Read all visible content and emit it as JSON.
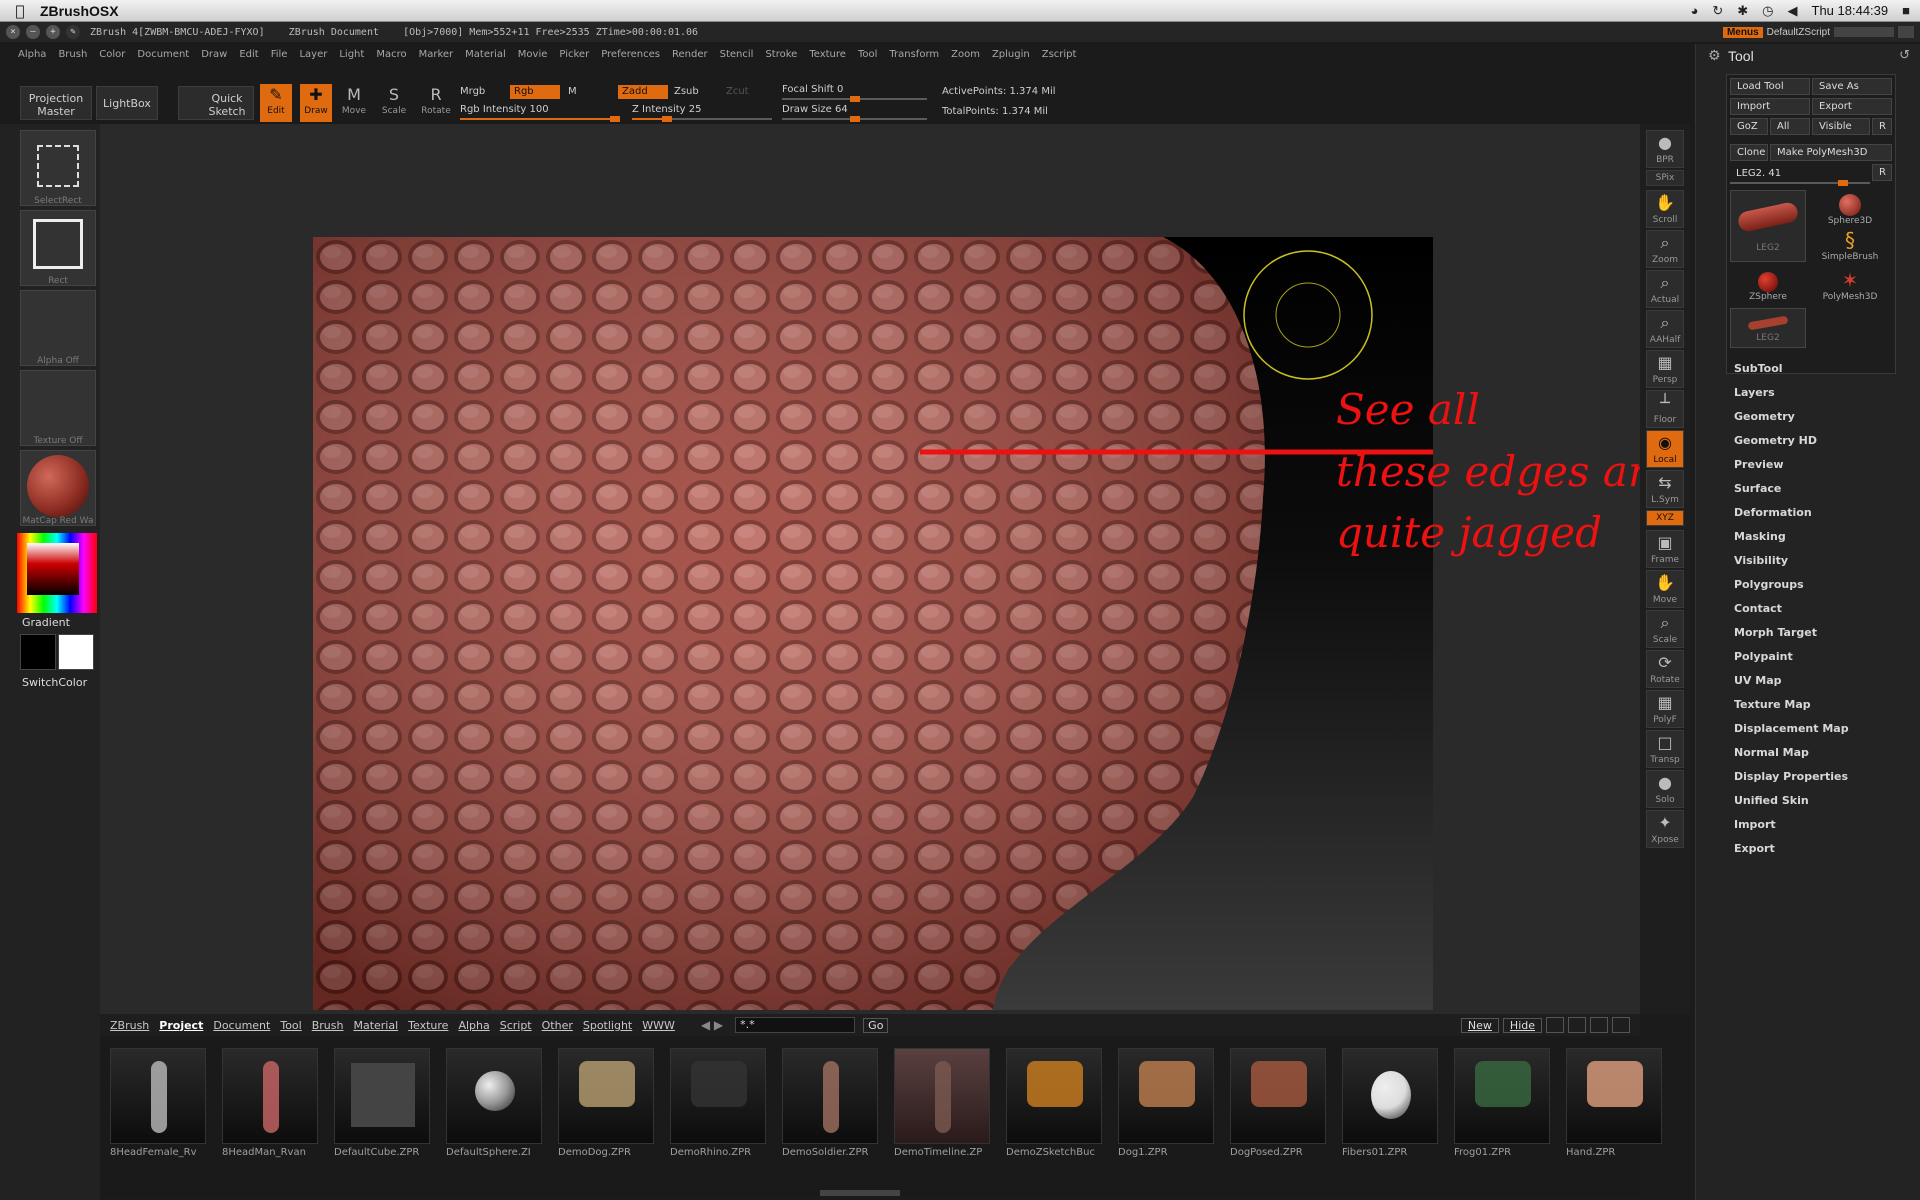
{
  "mac": {
    "app": "ZBrushOSX",
    "clock": "Thu 18:44:39"
  },
  "titlebar": {
    "info": "ZBrush 4[ZWBM-BMCU-ADEJ-FYXO]    ZBrush Document    [Obj>7000] Mem>552+11 Free>2535 ZTime>00:00:01.06",
    "menus": "Menus",
    "script": "DefaultZScript"
  },
  "menu": [
    "Alpha",
    "Brush",
    "Color",
    "Document",
    "Draw",
    "Edit",
    "File",
    "Layer",
    "Light",
    "Macro",
    "Marker",
    "Material",
    "Movie",
    "Picker",
    "Preferences",
    "Render",
    "Stencil",
    "Stroke",
    "Texture",
    "Tool",
    "Transform",
    "Zoom",
    "Zplugin",
    "Zscript"
  ],
  "toolbar": {
    "projection_master": "Projection Master",
    "lightbox": "LightBox",
    "quick_sketch": "Quick Sketch",
    "edit": "Edit",
    "draw": "Draw",
    "move": "Move",
    "scale": "Scale",
    "rotate": "Rotate",
    "mrgb": "Mrgb",
    "rgb": "Rgb",
    "m": "M",
    "zadd": "Zadd",
    "zsub": "Zsub",
    "zcut": "Zcut",
    "rgb_intensity": "Rgb Intensity 100",
    "z_intensity": "Z Intensity 25",
    "focal_shift": "Focal Shift 0",
    "draw_size": "Draw Size 64",
    "active_points": "ActivePoints: 1.374 Mil",
    "total_points": "TotalPoints: 1.374 Mil",
    "rgb_intensity_value": 100,
    "z_intensity_value": 25,
    "focal_shift_value": 0,
    "draw_size_value": 64
  },
  "left": {
    "select_rect": "SelectRect",
    "rect": "Rect",
    "alpha_off": "Alpha  Off",
    "texture_off": "Texture  Off",
    "matcap": "MatCap  Red  Wa",
    "gradient": "Gradient",
    "switch_color": "SwitchColor"
  },
  "right_icons": [
    "BPR",
    "SPix",
    "Scroll",
    "Zoom",
    "Actual",
    "AAHalf",
    "Persp",
    "Floor",
    "Local",
    "L.Sym",
    "XYZ",
    "Frame",
    "Move",
    "Scale",
    "Rotate",
    "PolyF",
    "Transp",
    "Solo",
    "Xpose"
  ],
  "annotation": [
    "See all",
    "these edges are",
    "quite jagged"
  ],
  "tool_panel": {
    "title": "Tool",
    "load_tool": "Load Tool",
    "save_as": "Save As",
    "import": "Import",
    "export": "Export",
    "goz": "GoZ",
    "all": "All",
    "visible": "Visible",
    "r": "R",
    "clone": "Clone",
    "make_polymesh": "Make PolyMesh3D",
    "leg_slider": "LEG2. 41",
    "thumbs": [
      "LEG2",
      "Sphere3D",
      "SimpleBrush",
      "ZSphere",
      "PolyMesh3D",
      "LEG2"
    ],
    "sections": [
      "SubTool",
      "Layers",
      "Geometry",
      "Geometry HD",
      "Preview",
      "Surface",
      "Deformation",
      "Masking",
      "Visibility",
      "Polygroups",
      "Contact",
      "Morph Target",
      "Polypaint",
      "UV Map",
      "Texture Map",
      "Displacement Map",
      "Normal Map",
      "Display Properties",
      "Unified Skin",
      "Import",
      "Export"
    ]
  },
  "lightbox": {
    "tabs": [
      "ZBrush",
      "Project",
      "Document",
      "Tool",
      "Brush",
      "Material",
      "Texture",
      "Alpha",
      "Script",
      "Other",
      "Spotlight",
      "WWW"
    ],
    "search": "*.*",
    "go": "Go",
    "new": "New",
    "hide": "Hide",
    "items": [
      "8HeadFemale_Rv",
      "8HeadMan_Rvan",
      "DefaultCube.ZPR",
      "DefaultSphere.ZI",
      "DemoDog.ZPR",
      "DemoRhino.ZPR",
      "DemoSoldier.ZPR",
      "DemoTimeline.ZP",
      "DemoZSketchBuc",
      "Dog1.ZPR",
      "DogPosed.ZPR",
      "Fibers01.ZPR",
      "Frog01.ZPR",
      "Hand.ZPR"
    ]
  },
  "colors": {
    "accent": "#e06a10",
    "skin": "#a8453a",
    "annotation": "#ee1111"
  }
}
